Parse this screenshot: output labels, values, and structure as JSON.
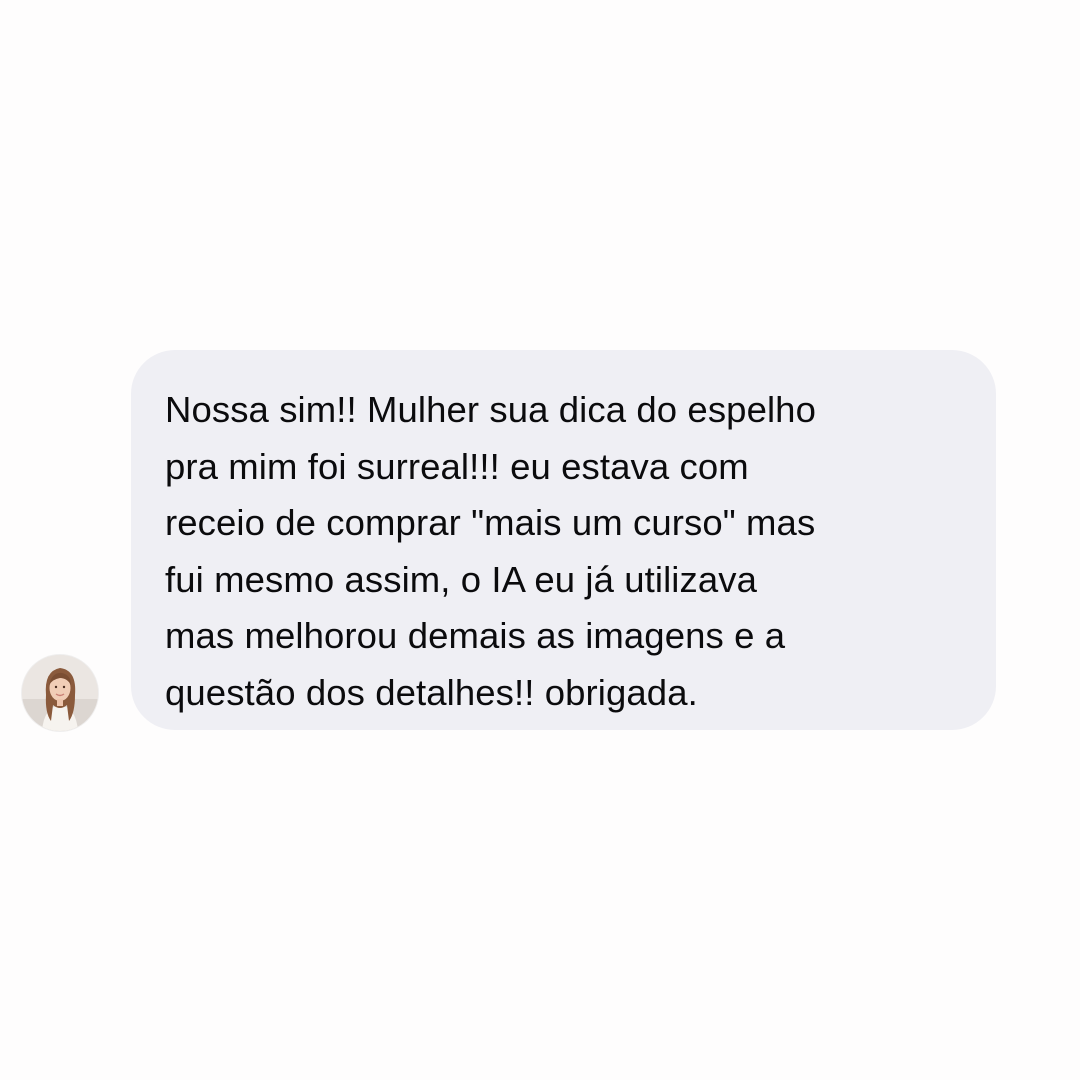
{
  "conversation": {
    "sender": {
      "avatar_icon": "profile-photo-avatar"
    },
    "message": {
      "text": "Nossa sim!! Mulher sua dica do espelho\npra mim foi surreal!!! eu estava com\nreceio de comprar \"mais um curso\" mas\nfui mesmo assim, o IA eu já utilizava\nmas melhorou demais as imagens e a\nquestão dos detalhes!! obrigada.",
      "bubble_color": "#efeff4",
      "text_color": "#0b0b0d"
    }
  }
}
